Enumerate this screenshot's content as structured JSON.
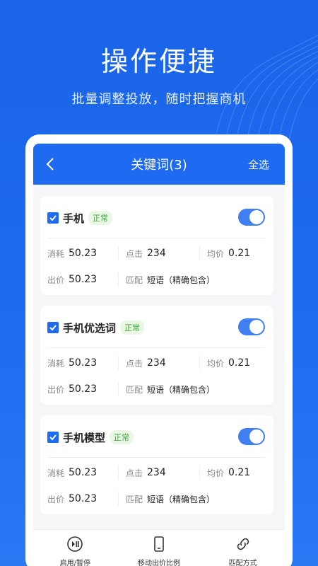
{
  "promo": {
    "title": "操作便捷",
    "subtitle": "批量调整投放，随时把握商机"
  },
  "nav": {
    "title": "关键词(3)",
    "select_all": "全选",
    "back_icon": "chevron-left-icon"
  },
  "keywords": [
    {
      "name": "手机",
      "status": "正常",
      "checked": true,
      "enabled": true,
      "cost_label": "消耗",
      "cost": "50.23",
      "clicks_label": "点击",
      "clicks": "234",
      "avg_label": "均价",
      "avg": "0.21",
      "bid_label": "出价",
      "bid": "50.23",
      "match_label": "匹配",
      "match": "短语（精确包含）"
    },
    {
      "name": "手机优选词",
      "status": "正常",
      "checked": true,
      "enabled": true,
      "cost_label": "消耗",
      "cost": "50.23",
      "clicks_label": "点击",
      "clicks": "234",
      "avg_label": "均价",
      "avg": "0.21",
      "bid_label": "出价",
      "bid": "50.23",
      "match_label": "匹配",
      "match": "短语（精确包含）"
    },
    {
      "name": "手机模型",
      "status": "正常",
      "checked": true,
      "enabled": true,
      "cost_label": "消耗",
      "cost": "50.23",
      "clicks_label": "点击",
      "clicks": "234",
      "avg_label": "均价",
      "avg": "0.21",
      "bid_label": "出价",
      "bid": "50.23",
      "match_label": "匹配",
      "match": "短语（精确包含）"
    }
  ],
  "toolbar": [
    {
      "label": "启用/暂停",
      "icon": "play-pause-icon"
    },
    {
      "label": "移动出价比例",
      "icon": "mobile-phone-icon"
    },
    {
      "label": "匹配方式",
      "icon": "link-icon"
    }
  ],
  "colors": {
    "brand": "#1e6af0",
    "toggle": "#3f7ff2",
    "status_text": "#3da83d",
    "status_bg": "#e9f7e4"
  }
}
